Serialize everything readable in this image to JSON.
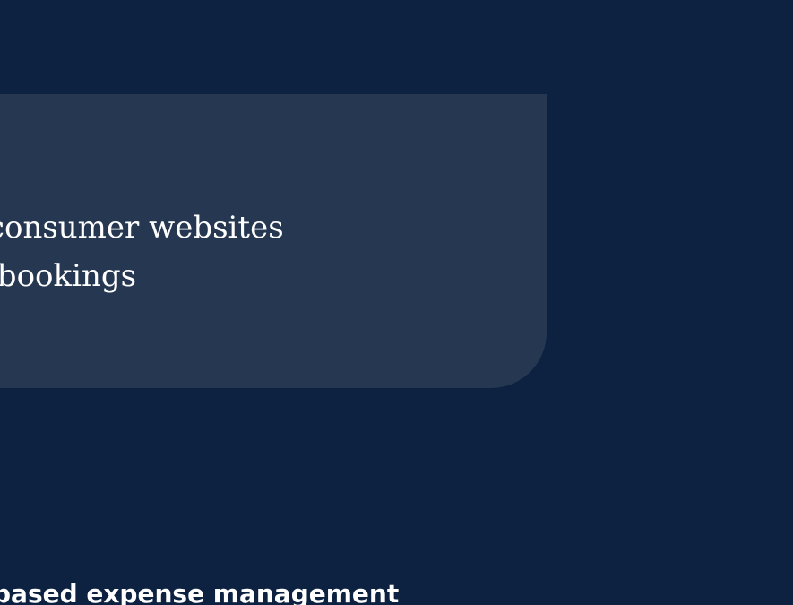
{
  "card": {
    "line1": "e consumer websites",
    "line2": "el bookings"
  },
  "section": {
    "heading": "based expense management"
  },
  "colors": {
    "background": "#0d2240",
    "card": "#253751",
    "text": "#ffffff"
  }
}
